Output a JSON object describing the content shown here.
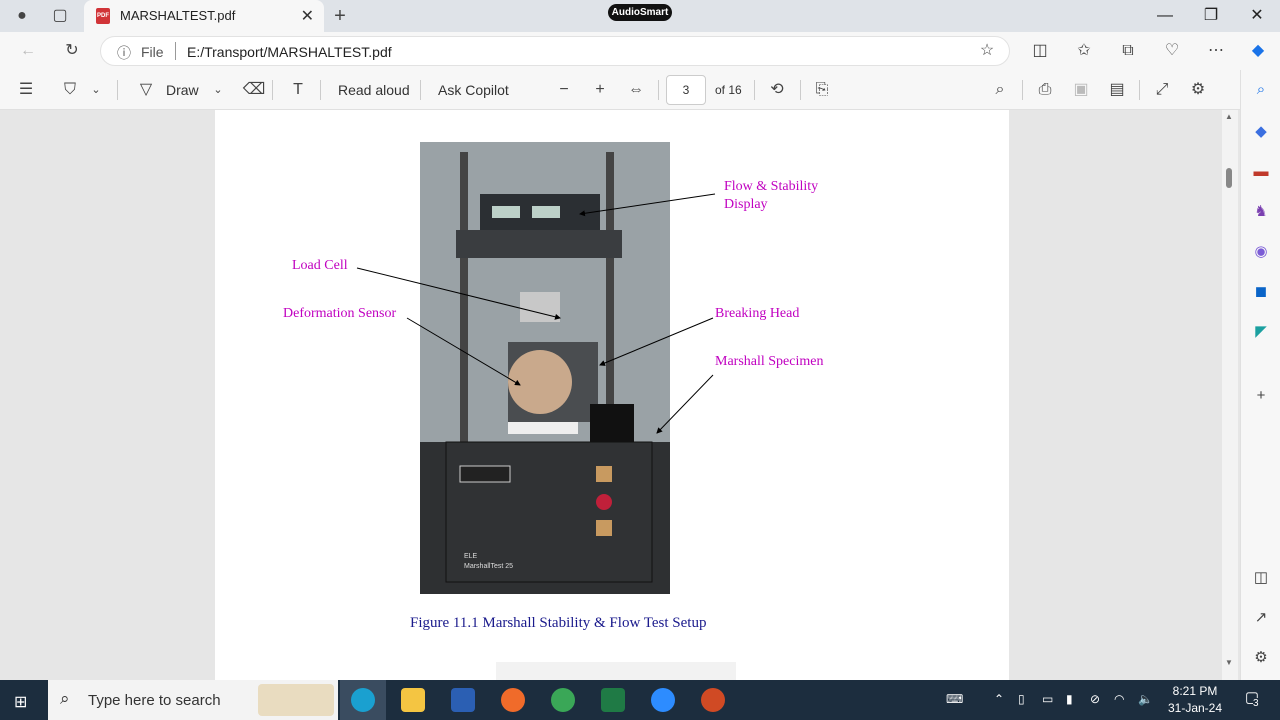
{
  "browser": {
    "tab_title": "MARSHALTEST.pdf",
    "tab_pdf_badge": "PDF",
    "overlay_badge": "AudioSmart",
    "file_label": "File",
    "url": "E:/Transport/MARSHALTEST.pdf"
  },
  "pdf_toolbar": {
    "draw_label": "Draw",
    "read_aloud_label": "Read aloud",
    "ask_copilot_label": "Ask Copilot",
    "page_number": "3",
    "page_total": "of 16"
  },
  "document": {
    "labels": {
      "flow_stability_line1": "Flow & Stability",
      "flow_stability_line2": "Display",
      "load_cell": "Load Cell",
      "deformation_sensor": "Deformation Sensor",
      "breaking_head": "Breaking Head",
      "marshall_specimen": "Marshall Specimen"
    },
    "caption": "Figure 11.1  Marshall Stability & Flow Test Setup",
    "machine_brand": "ELE",
    "machine_model": "MarshallTest 25"
  },
  "taskbar": {
    "search_placeholder": "Type here to search",
    "time": "8:21 PM",
    "date": "31-Jan-24",
    "notification_count": "3"
  }
}
